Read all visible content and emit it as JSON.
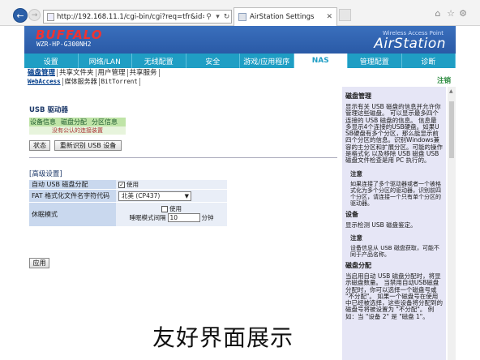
{
  "browser": {
    "url": "http://192.168.11.1/cgi-bin/cgi?req=tfr&id=32&rand=",
    "tab_title": "AirStation Settings"
  },
  "banner": {
    "brand": "BUFFALO",
    "model": "WZR-HP-G300NH2",
    "subtitle": "Wireless Access Point",
    "product": "AirStation"
  },
  "menu": [
    "设置",
    "网络/LAN",
    "无线配置",
    "安全",
    "游戏/应用程序",
    "NAS",
    "管理配置",
    "诊断"
  ],
  "subnav1": [
    "磁盘管理",
    "共享文件夹",
    "用户管理",
    "共享服务"
  ],
  "subnav2": [
    "WebAccess",
    "媒体服务器",
    "BitTorrent"
  ],
  "note_label": "注销",
  "main": {
    "usb_title": "USB 驱动器",
    "usb_tabs": [
      "设备信息",
      "磁盘分配",
      "分区信息"
    ],
    "usb_status": "没有公认的连接装置",
    "status_btn": "状态",
    "rescan_btn": "重新识别 USB 设备",
    "adv_title": "[高级设置]",
    "auto_label": "自动 USB 磁盘分配",
    "auto_value": "使用",
    "fat_label": "FAT 格式化文件名字符代码",
    "fat_value": "北美 (CP437)",
    "sleep_label": "休眠模式",
    "sleep_value": "使用",
    "sleep_interval_label": "睡眠模式间隔",
    "sleep_interval": "10",
    "sleep_unit": "分钟",
    "apply_btn": "应用"
  },
  "help": {
    "t1": "磁盘管理",
    "p1": "显示有关 USB 磁盘的信息并允许你管理这些磁盘。 可以显示最多四个连接的 USB 磁盘的信息。 信息最多显示4个连接的USB硬盘。如果USB硬盘有多个分区，那么能显示前四个分区的信息。识别Windows兼容的主分区和扩展分区。可能的操作是格式化 以及移除 USB 磁盘 USB 磁盘文件检查是用 PC 执行的。",
    "n1_title": "注意",
    "n1": "如果连接了多个驱动器或者一个被格式化为多个分区的驱动器，识别前四个分区，请连接一个只有单个分区的驱动器。",
    "t2": "设备",
    "p2": "显示检测 USB 磁盘鉴定。",
    "n2_title": "注意",
    "n2": "设备信息从 USB 磁盘获取，可能不同于产品名称。",
    "t3": "磁盘分配",
    "p3": "当启用自动 USB 磁盘分配时，将显示磁盘数量。 当禁用自动USB磁盘分配时，你可以选择一个磁盘号或 \"不分配\"。 如果一个磁盘号在使用中已经被选择，这些设备将分配到的磁盘号将被设置为 \"不分配\"。 例如：当 \"设备 2\" 是 \"磁盘 1\"。"
  },
  "overlay": "友好界面展示"
}
